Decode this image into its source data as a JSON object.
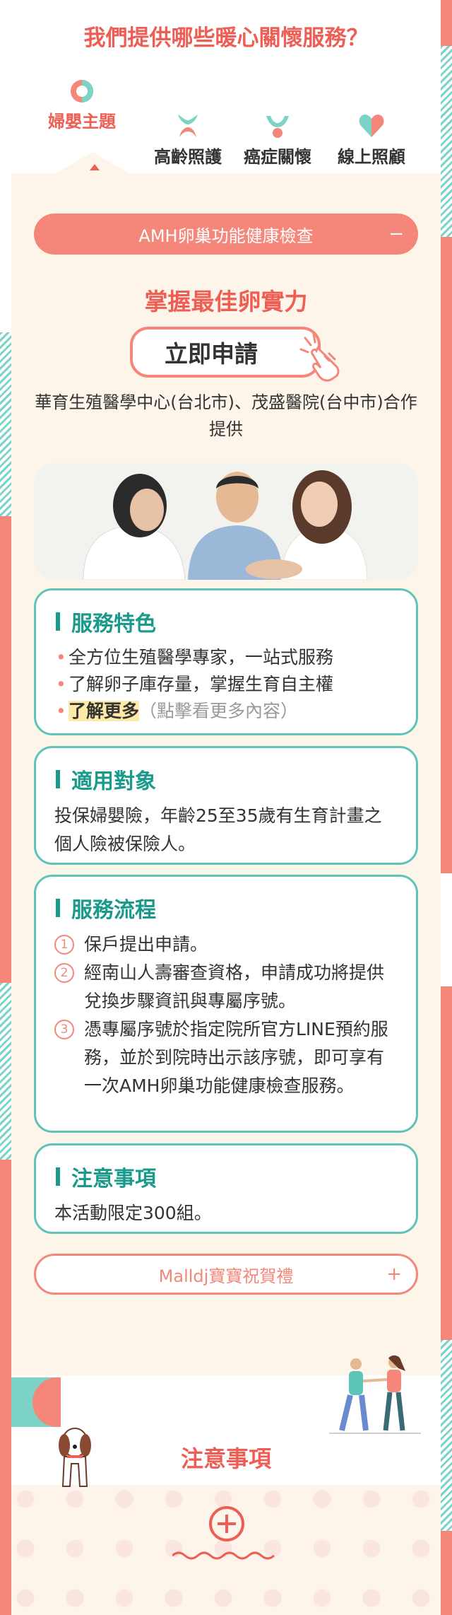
{
  "page_title": "我們提供哪些暖心關懷服務？",
  "tabs": [
    {
      "label": "婦嬰主題",
      "icon": "mother-baby-icon",
      "active": true
    },
    {
      "label": "高齡照護",
      "icon": "elder-care-icon",
      "active": false
    },
    {
      "label": "癌症關懷",
      "icon": "cancer-care-icon",
      "active": false
    },
    {
      "label": "線上照顧",
      "icon": "heart-icon",
      "active": false
    }
  ],
  "accordion_open": {
    "label": "AMH卵巢功能健康檢查",
    "toggle": "−"
  },
  "headline": "掌握最佳卵實力",
  "apply_button": "立即申請",
  "partner_text": "華育生殖醫學中心(台北市)、茂盛醫院(台中市)合作提供",
  "features": {
    "title": "服務特色",
    "items": [
      "全方位生殖醫學專家，一站式服務",
      "了解卵子庫存量，掌握生育自主權"
    ],
    "more_link": "了解更多",
    "more_hint": "（點擊看更多內容）"
  },
  "eligibility": {
    "title": "適用對象",
    "text": "投保婦嬰險，年齡25至35歲有生育計畫之個人險被保險人。"
  },
  "process": {
    "title": "服務流程",
    "steps": [
      {
        "num": "1",
        "text": "保戶提出申請。"
      },
      {
        "num": "2",
        "text": "經南山人壽審查資格，申請成功將提供兌換步驟資訊與專屬序號。"
      },
      {
        "num": "3",
        "text": "憑專屬序號於指定院所官方LINE預約服務，並於到院時出示該序號，即可享有一次AMH卵巢功能健康檢查服務。"
      }
    ]
  },
  "notes": {
    "title": "注意事項",
    "text": "本活動限定300組。"
  },
  "accordion_closed": {
    "label": "Malldj寶寶祝賀禮",
    "toggle": "+"
  },
  "bottom_title": "注意事項",
  "colors": {
    "coral": "#f4877a",
    "red": "#ee5e55",
    "teal": "#1a9a8a",
    "cream": "#fdf4ea"
  }
}
